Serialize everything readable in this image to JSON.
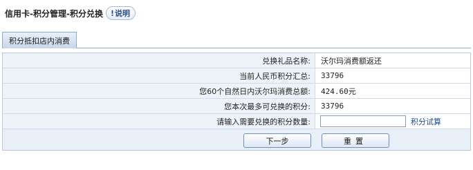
{
  "header": {
    "title": "信用卡-积分管理-积分兑换",
    "help_label": "说明",
    "help_icon": "info-icon"
  },
  "tabs": [
    {
      "label": "积分抵扣店内消费",
      "active": true
    }
  ],
  "form": {
    "rows": [
      {
        "label": "兑换礼品名称:",
        "value": "沃尔玛消费额返还"
      },
      {
        "label": "当前人民币积分汇总:",
        "value": "33796"
      },
      {
        "label": "您60个自然日内沃尔玛消费总额:",
        "value": "424.60元"
      },
      {
        "label": "您本次最多可兑换的积分:",
        "value": "33796"
      }
    ],
    "input_row": {
      "label": "请输入需要兑换的积分数量:",
      "value": "",
      "placeholder": "",
      "link_label": "积分试算"
    }
  },
  "buttons": {
    "next_label": "下一步",
    "reset_label": "重置"
  },
  "colors": {
    "label_bg": "#eef3f9",
    "border": "#cfdbe9",
    "tab_bg": "#c7d6ea",
    "link": "#1f4c8f"
  }
}
